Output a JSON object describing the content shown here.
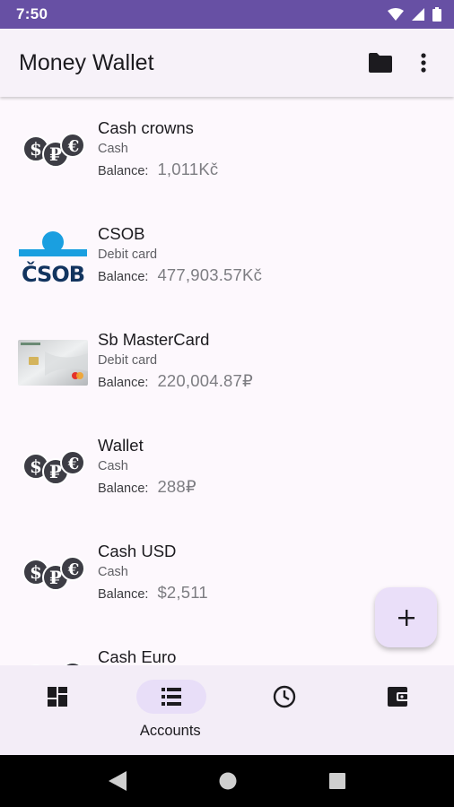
{
  "status_bar": {
    "time": "7:50"
  },
  "app_bar": {
    "title": "Money Wallet"
  },
  "accounts": [
    {
      "name": "Cash crowns",
      "type": "Cash",
      "balance_label": "Balance:",
      "balance": "1,011Kč",
      "icon": "cash-coins-icon"
    },
    {
      "name": "CSOB",
      "type": "Debit card",
      "balance_label": "Balance:",
      "balance": "477,903.57Kč",
      "icon": "csob-logo",
      "logo_text": "ČSOB"
    },
    {
      "name": "Sb MasterCard",
      "type": "Debit card",
      "balance_label": "Balance:",
      "balance": "220,004.87₽",
      "icon": "bank-card-icon"
    },
    {
      "name": "Wallet",
      "type": "Cash",
      "balance_label": "Balance:",
      "balance": "288₽",
      "icon": "cash-coins-icon"
    },
    {
      "name": "Cash USD",
      "type": "Cash",
      "balance_label": "Balance:",
      "balance": "$2,511",
      "icon": "cash-coins-icon"
    },
    {
      "name": "Cash Euro",
      "type": "",
      "balance_label": "",
      "balance": "",
      "icon": "cash-coins-icon"
    }
  ],
  "bottom_nav": [
    {
      "label": "",
      "icon": "dashboard-icon",
      "active": false
    },
    {
      "label": "Accounts",
      "icon": "list-icon",
      "active": true
    },
    {
      "label": "",
      "icon": "clock-icon",
      "active": false
    },
    {
      "label": "",
      "icon": "wallet-icon",
      "active": false
    }
  ],
  "colors": {
    "status_bar": "#6750a4",
    "fab": "#eadff9",
    "nav_active": "#e8def8",
    "csob_blue": "#1a9fe0",
    "csob_navy": "#12345f"
  }
}
